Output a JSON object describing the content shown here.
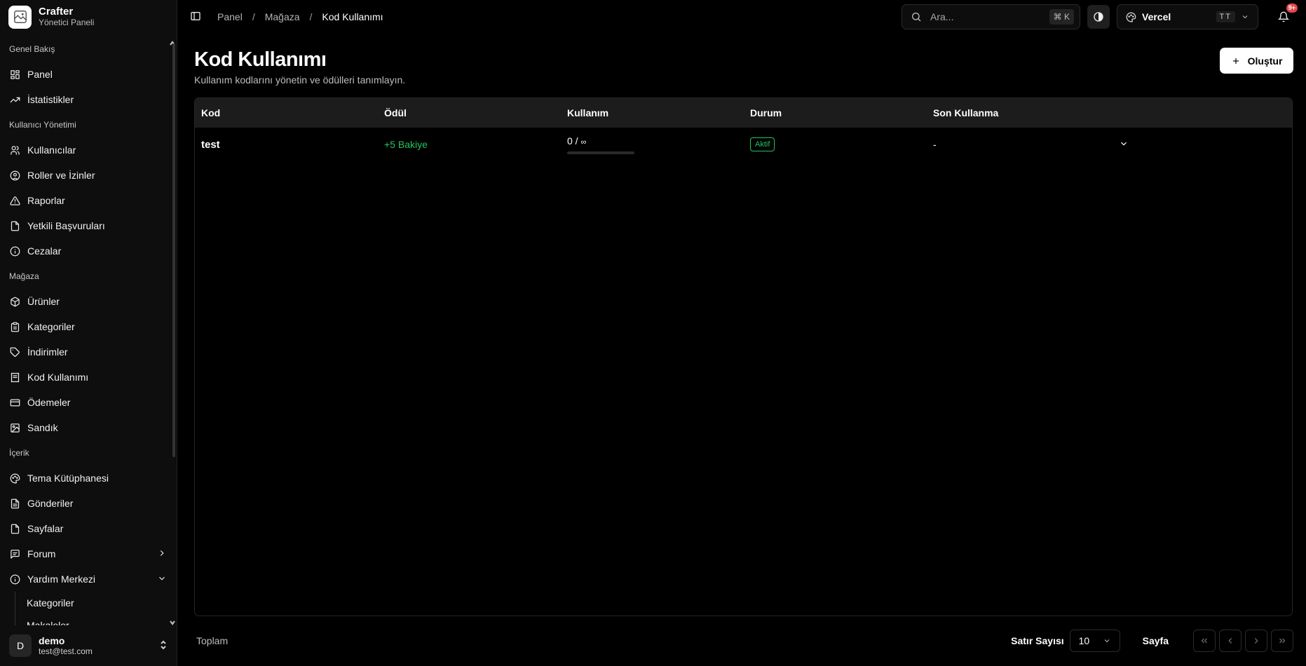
{
  "brand": {
    "name": "Crafter",
    "subtitle": "Yönetici Paneli"
  },
  "sidebar": {
    "sections": [
      {
        "label": "Genel Bakış",
        "items": [
          {
            "label": "Panel",
            "icon": "dashboard-icon"
          },
          {
            "label": "İstatistikler",
            "icon": "trending-up-icon"
          }
        ]
      },
      {
        "label": "Kullanıcı Yönetimi",
        "items": [
          {
            "label": "Kullanıcılar",
            "icon": "users-icon"
          },
          {
            "label": "Roller ve İzinler",
            "icon": "user-circle-icon"
          },
          {
            "label": "Raporlar",
            "icon": "warning-triangle-icon"
          },
          {
            "label": "Yetkili Başvuruları",
            "icon": "file-icon"
          },
          {
            "label": "Cezalar",
            "icon": "info-icon"
          }
        ]
      },
      {
        "label": "Mağaza",
        "items": [
          {
            "label": "Ürünler",
            "icon": "package-icon"
          },
          {
            "label": "Kategoriler",
            "icon": "clipboard-icon"
          },
          {
            "label": "İndirimler",
            "icon": "tag-icon"
          },
          {
            "label": "Kod Kullanımı",
            "icon": "receipt-icon"
          },
          {
            "label": "Ödemeler",
            "icon": "credit-card-icon"
          },
          {
            "label": "Sandık",
            "icon": "image-icon"
          }
        ]
      },
      {
        "label": "İçerik",
        "items": [
          {
            "label": "Tema Kütüphanesi",
            "icon": "palette-icon"
          },
          {
            "label": "Gönderiler",
            "icon": "file-text-icon"
          },
          {
            "label": "Sayfalar",
            "icon": "page-icon"
          },
          {
            "label": "Forum",
            "icon": "message-icon"
          },
          {
            "label": "Yardım Merkezi",
            "icon": "help-icon"
          }
        ]
      }
    ],
    "help_sub": [
      "Kategoriler",
      "Makaleler"
    ]
  },
  "user": {
    "initial": "D",
    "name": "demo",
    "email": "test@test.com"
  },
  "topbar": {
    "breadcrumbs": [
      "Panel",
      "Mağaza",
      "Kod Kullanımı"
    ],
    "search_placeholder": "Ara...",
    "search_shortcut": "⌘ K",
    "team_name": "Vercel",
    "team_badge": "TT",
    "notif_badge": "9+"
  },
  "page": {
    "title": "Kod Kullanımı",
    "subtitle": "Kullanım kodlarını yönetin ve ödülleri tanımlayın.",
    "create_label": "Oluştur"
  },
  "table": {
    "columns": [
      "Kod",
      "Ödül",
      "Kullanım",
      "Durum",
      "Son Kullanma"
    ],
    "rows": [
      {
        "code": "test",
        "reward": "+5 Bakiye",
        "usage_count": "0 / ",
        "usage_limit": "∞",
        "usage_fraction": 0,
        "status": "Aktif",
        "expiry": "-"
      }
    ]
  },
  "footer": {
    "total_label": "Toplam",
    "rows_label": "Satır Sayısı",
    "rows_value": "10",
    "page_label": "Sayfa"
  },
  "colors": {
    "accent": "#22c55e",
    "badge": "#e5484d",
    "background": "#000000"
  }
}
